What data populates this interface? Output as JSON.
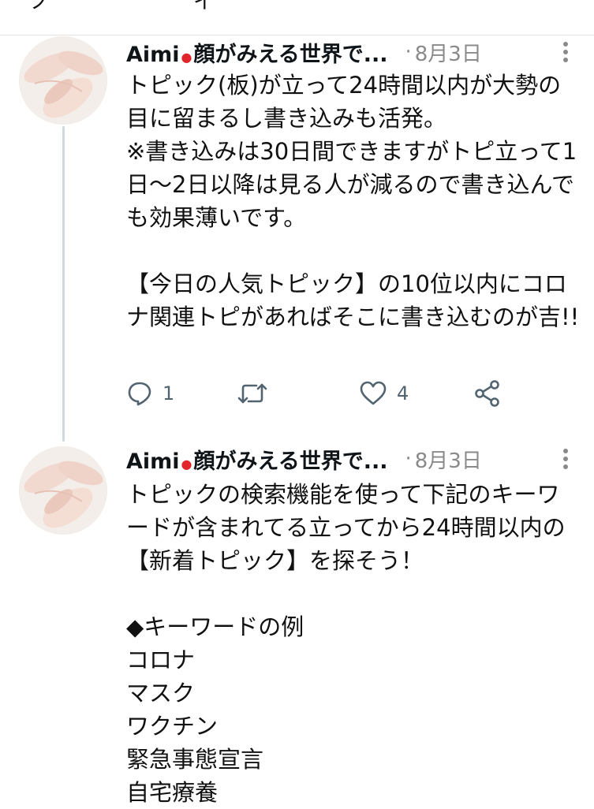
{
  "tweets": [
    {
      "display_name": "Aimi",
      "handle_suffix": "顔がみえる世界で...",
      "flag_icon": "red-circle-flag",
      "separator": "·",
      "date": "8月3日",
      "text": "トピック(板)が立って24時間以内が大勢の目に留まるし書き込みも活発。\n※書き込みは30日間できますがトピ立って1日〜2日以降は見る人が減るので書き込んでも効果薄いです。\n\n【今日の人気トピック】の10位以内にコロナ関連トピがあればそこに書き込むのが吉!!",
      "actions": {
        "reply_count": "1",
        "retweet_count": "",
        "like_count": "4"
      }
    },
    {
      "display_name": "Aimi",
      "handle_suffix": "顔がみえる世界で...",
      "flag_icon": "red-circle-flag",
      "separator": "·",
      "date": "8月3日",
      "text": "トピックの検索機能を使って下記のキーワードが含まれてる立ってから24時間以内の【新着トピック】を探そう！\n\n◆キーワードの例\nコロナ\nマスク\nワクチン\n緊急事態宣言\n自宅療養"
    }
  ],
  "colors": {
    "text": "#111111",
    "secondary": "#8a8a8a",
    "action_icon": "#536471",
    "thread_line": "#cfd9de",
    "flag": "#e2252b"
  }
}
